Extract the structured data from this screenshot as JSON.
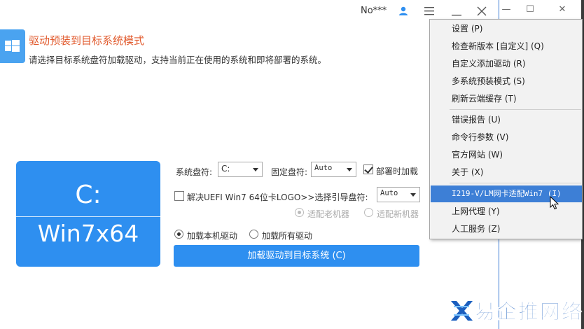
{
  "titlebar": {
    "user": "No***"
  },
  "header": {
    "title": "驱动预装到目标系统模式",
    "description": "请选择目标系统盘符加载驱动，支持当前正在使用的系统和即将部署的系统。"
  },
  "drive_tile": {
    "letter": "C:",
    "os": "Win7x64"
  },
  "form": {
    "system_drive_label": "系统盘符:",
    "system_drive_value": "C:",
    "fixed_drive_label": "固定盘符:",
    "fixed_drive_value": "Auto",
    "deploy_load_label": "部署时加载",
    "deploy_load_checked": true,
    "uefi_label": "解决UEFI Win7 64位卡LOGO>>选择引导盘符:",
    "uefi_checked": false,
    "boot_drive_value": "Auto",
    "old_machine_label": "适配老机器",
    "new_machine_label": "适配新机器",
    "load_local_label": "加载本机驱动",
    "load_all_label": "加载所有驱动",
    "load_button": "加载驱动到目标系统 (C)"
  },
  "menu": {
    "items": [
      {
        "label": "设置 (P)"
      },
      {
        "label": "检查新版本 [自定义] (Q)"
      },
      {
        "label": "自定义添加驱动 (R)"
      },
      {
        "label": "多系统预装模式 (S)"
      },
      {
        "label": "刷新云端缓存 (T)"
      },
      {
        "label": "错误报告 (U)"
      },
      {
        "label": "命令行参数 (V)"
      },
      {
        "label": "官方网站 (W)"
      },
      {
        "label": "关于 (X)"
      },
      {
        "label": "I219-V/LM网卡适配Win7 (I)"
      },
      {
        "label": "上网代理 (Y)"
      },
      {
        "label": "人工服务 (Z)"
      }
    ]
  },
  "watermark": {
    "text": "易企推网络"
  },
  "colors": {
    "accent": "#2e8ff0",
    "title": "#e15a2d",
    "menu_highlight": "#3d7fd6"
  }
}
